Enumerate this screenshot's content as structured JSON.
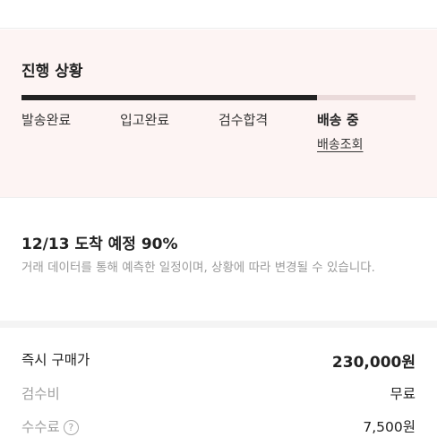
{
  "progress": {
    "title": "진행 상황",
    "fill_fraction": 0.75,
    "steps": [
      {
        "label": "발송완료"
      },
      {
        "label": "입고완료"
      },
      {
        "label": "검수합격"
      },
      {
        "label": "배송 중"
      }
    ],
    "track_link": "배송조회"
  },
  "eta": {
    "title": "12/13 도착 예정 90%",
    "description": "거래 데이터를 통해 예측한 일정이며, 상황에 따라 변경될 수 있습니다."
  },
  "price": {
    "rows": [
      {
        "label": "즉시 구매가",
        "value": "230,000원"
      },
      {
        "label": "검수비",
        "value": "무료"
      },
      {
        "label": "수수료",
        "value": "7,500원",
        "help_glyph": "?"
      }
    ]
  },
  "colors": {
    "progress_background": "#fdf4f3",
    "progress_fill": "#222222",
    "progress_track": "#eadada"
  },
  "icons": {
    "help": "question-circle-icon"
  }
}
